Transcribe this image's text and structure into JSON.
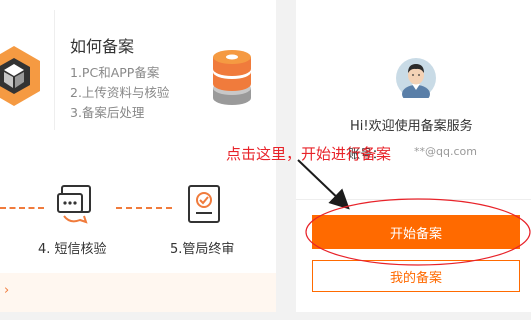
{
  "how_to": {
    "title": "如何备案",
    "steps": [
      "1.PC和APP备案",
      "2.上传资料与核验",
      "3.备案后处理"
    ]
  },
  "process": {
    "sms_verify_label": "4. 短信核验",
    "final_review_label": "5.管局终审",
    "more_link": "›"
  },
  "user_panel": {
    "welcome": "Hi!欢迎使用备案服务",
    "account_label": "账号：",
    "account_value": "**@qq.com",
    "start_button": "开始备案",
    "my_button": "我的备案"
  },
  "annotation": {
    "text": "点击这里，开始进行备案"
  },
  "colors": {
    "accent": "#ff6a00",
    "annotation": "#e8232a",
    "dash": "#f07b3c"
  }
}
